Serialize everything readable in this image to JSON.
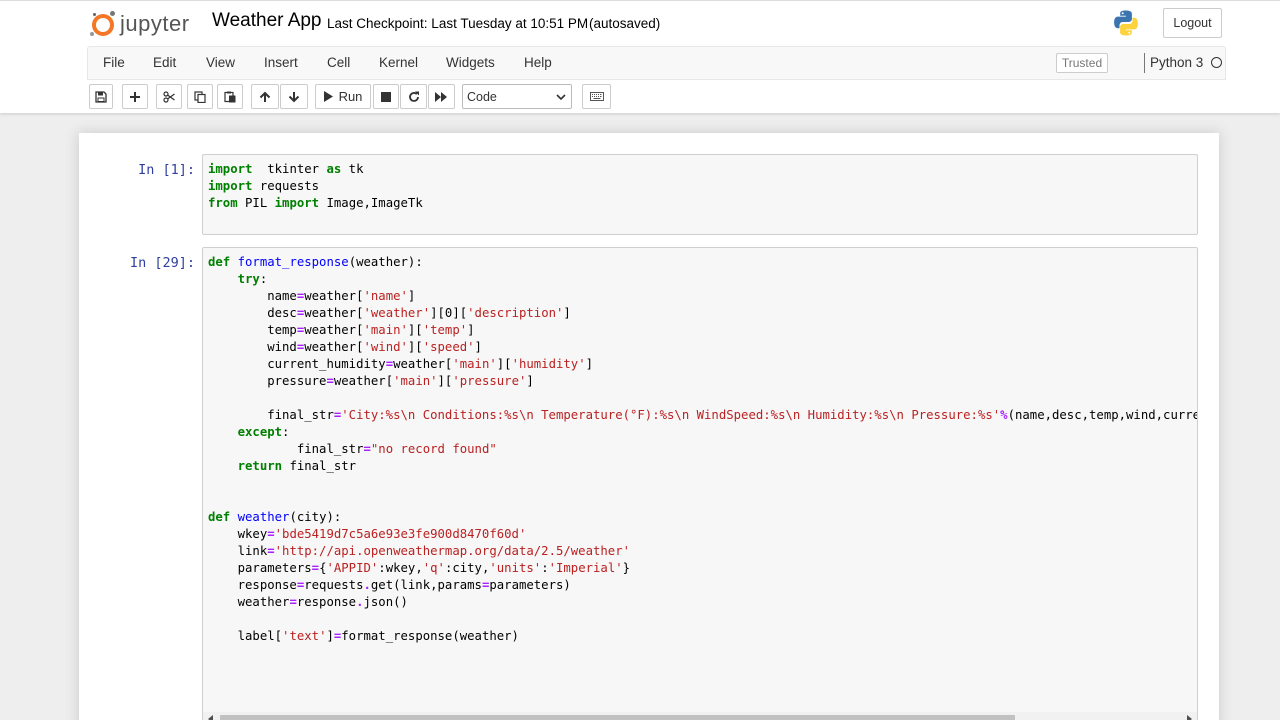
{
  "header": {
    "logo_text": "jupyter",
    "notebook_name": "Weather App",
    "checkpoint": "Last Checkpoint: Last Tuesday at 10:51 PM",
    "autosave_status": "(autosaved)",
    "logout_label": "Logout"
  },
  "menubar": {
    "items": [
      {
        "label": "File"
      },
      {
        "label": "Edit"
      },
      {
        "label": "View"
      },
      {
        "label": "Insert"
      },
      {
        "label": "Cell"
      },
      {
        "label": "Kernel"
      },
      {
        "label": "Widgets"
      },
      {
        "label": "Help"
      }
    ],
    "trusted_label": "Trusted",
    "kernel_name": "Python 3"
  },
  "toolbar": {
    "run_label": "Run",
    "cell_type": "Code",
    "icons": [
      "save-icon",
      "plus-icon",
      "cut-icon",
      "copy-icon",
      "paste-icon",
      "arrow-up-icon",
      "arrow-down-icon",
      "play-icon",
      "stop-icon",
      "restart-icon",
      "fast-forward-icon",
      "keyboard-icon"
    ]
  },
  "cells": [
    {
      "prompt": "In [1]:",
      "lines": [
        [
          [
            "kw",
            "import"
          ],
          [
            "",
            "  tkinter "
          ],
          [
            "kw",
            "as"
          ],
          [
            "",
            " tk"
          ]
        ],
        [
          [
            "kw",
            "import"
          ],
          [
            "",
            " requests"
          ]
        ],
        [
          [
            "kw",
            "from"
          ],
          [
            "",
            " PIL "
          ],
          [
            "kw",
            "import"
          ],
          [
            "",
            " Image,ImageTk"
          ]
        ]
      ]
    },
    {
      "prompt": "In [29]:",
      "lines": [
        [
          [
            "kw",
            "def"
          ],
          [
            "",
            " "
          ],
          [
            "fn",
            "format_response"
          ],
          [
            "",
            "(weather):"
          ]
        ],
        [
          [
            "",
            "    "
          ],
          [
            "kw",
            "try"
          ],
          [
            "",
            ":"
          ]
        ],
        [
          [
            "",
            "        name"
          ],
          [
            "op",
            "="
          ],
          [
            "",
            "weather["
          ],
          [
            "str",
            "'name'"
          ],
          [
            "",
            "]"
          ]
        ],
        [
          [
            "",
            "        desc"
          ],
          [
            "op",
            "="
          ],
          [
            "",
            "weather["
          ],
          [
            "str",
            "'weather'"
          ],
          [
            "",
            "][0]["
          ],
          [
            "str",
            "'description'"
          ],
          [
            "",
            "]"
          ]
        ],
        [
          [
            "",
            "        temp"
          ],
          [
            "op",
            "="
          ],
          [
            "",
            "weather["
          ],
          [
            "str",
            "'main'"
          ],
          [
            "",
            "]["
          ],
          [
            "str",
            "'temp'"
          ],
          [
            "",
            "]"
          ]
        ],
        [
          [
            "",
            "        wind"
          ],
          [
            "op",
            "="
          ],
          [
            "",
            "weather["
          ],
          [
            "str",
            "'wind'"
          ],
          [
            "",
            "]["
          ],
          [
            "str",
            "'speed'"
          ],
          [
            "",
            "]"
          ]
        ],
        [
          [
            "",
            "        current_humidity"
          ],
          [
            "op",
            "="
          ],
          [
            "",
            "weather["
          ],
          [
            "str",
            "'main'"
          ],
          [
            "",
            "]["
          ],
          [
            "str",
            "'humidity'"
          ],
          [
            "",
            "]"
          ]
        ],
        [
          [
            "",
            "        pressure"
          ],
          [
            "op",
            "="
          ],
          [
            "",
            "weather["
          ],
          [
            "str",
            "'main'"
          ],
          [
            "",
            "]["
          ],
          [
            "str",
            "'pressure'"
          ],
          [
            "",
            "]"
          ]
        ],
        [
          [
            "",
            ""
          ]
        ],
        [
          [
            "",
            "        final_str"
          ],
          [
            "op",
            "="
          ],
          [
            "str",
            "'City:%s\\n Conditions:%s\\n Temperature(°F):%s\\n WindSpeed:%s\\n Humidity:%s\\n Pressure:%s'"
          ],
          [
            "op",
            "%"
          ],
          [
            "",
            "(name,desc,temp,wind,current_humidity,pressure)"
          ]
        ],
        [
          [
            "",
            "    "
          ],
          [
            "kw",
            "except"
          ],
          [
            "",
            ":"
          ]
        ],
        [
          [
            "",
            "            final_str"
          ],
          [
            "op",
            "="
          ],
          [
            "str",
            "\"no record found\""
          ]
        ],
        [
          [
            "",
            "    "
          ],
          [
            "kw",
            "return"
          ],
          [
            "",
            " final_str"
          ]
        ],
        [
          [
            "",
            ""
          ]
        ],
        [
          [
            "",
            ""
          ]
        ],
        [
          [
            "kw",
            "def"
          ],
          [
            "",
            " "
          ],
          [
            "fn",
            "weather"
          ],
          [
            "",
            "(city):"
          ]
        ],
        [
          [
            "",
            "    wkey"
          ],
          [
            "op",
            "="
          ],
          [
            "str",
            "'bde5419d7c5a6e93e3fe900d8470f60d'"
          ]
        ],
        [
          [
            "",
            "    link"
          ],
          [
            "op",
            "="
          ],
          [
            "str",
            "'http://api.openweathermap.org/data/2.5/weather'"
          ]
        ],
        [
          [
            "",
            "    parameters"
          ],
          [
            "op",
            "="
          ],
          [
            "",
            "{"
          ],
          [
            "str",
            "'APPID'"
          ],
          [
            "",
            ":wkey,"
          ],
          [
            "str",
            "'q'"
          ],
          [
            "",
            ":city,"
          ],
          [
            "str",
            "'units'"
          ],
          [
            "",
            ":"
          ],
          [
            "str",
            "'Imperial'"
          ],
          [
            "",
            "}"
          ]
        ],
        [
          [
            "",
            "    response"
          ],
          [
            "op",
            "="
          ],
          [
            "",
            "requests"
          ],
          [
            "op",
            "."
          ],
          [
            "",
            "get(link,params"
          ],
          [
            "op",
            "="
          ],
          [
            "",
            "parameters)"
          ]
        ],
        [
          [
            "",
            "    weather"
          ],
          [
            "op",
            "="
          ],
          [
            "",
            "response"
          ],
          [
            "op",
            "."
          ],
          [
            "",
            "json()"
          ]
        ],
        [
          [
            "",
            ""
          ]
        ],
        [
          [
            "",
            "    label["
          ],
          [
            "str",
            "'text'"
          ],
          [
            "",
            "]"
          ],
          [
            "op",
            "="
          ],
          [
            "",
            "format_response(weather)"
          ]
        ]
      ]
    }
  ]
}
